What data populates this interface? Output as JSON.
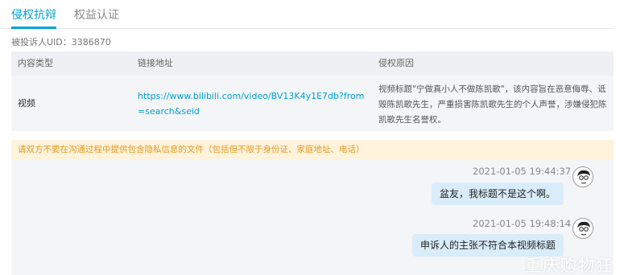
{
  "tabs": [
    {
      "label": "侵权抗辩",
      "active": true
    },
    {
      "label": "权益认证",
      "active": false
    }
  ],
  "complaint": {
    "uid_label": "被投诉人UID：",
    "uid_value": "3386870"
  },
  "table": {
    "headers": [
      "内容类型",
      "链接地址",
      "侵权原因"
    ],
    "row": {
      "type": "视频",
      "link": "https://www.bilibili.com/video/BV13K4y1E7db?from=search&seid",
      "reason": "视频标题\"宁做真小人不做陈凯歌\"，该内容旨在恶意侮辱、诋毁陈凯歌先生，严重损害陈凯歌先生的个人声誉，涉嫌侵犯陈凯歌先生名誉权。"
    }
  },
  "notice": "请双方不要在沟通过程中提供包含隐私信息的文件（包括但不限于身份证、家庭地址、电话）",
  "messages": [
    {
      "time": "2021-01-05 19:44:37",
      "text": "盆友，我标题不是这个啊。"
    },
    {
      "time": "2021-01-05 19:48:14",
      "text": "申诉人的主张不符合本视频标题"
    }
  ],
  "watermark": "重庆购物狂",
  "colors": {
    "accent": "#00a1d6",
    "notice_bg": "#fff3dc",
    "notice_text": "#e59a22",
    "bubble": "#d9ecfa"
  }
}
